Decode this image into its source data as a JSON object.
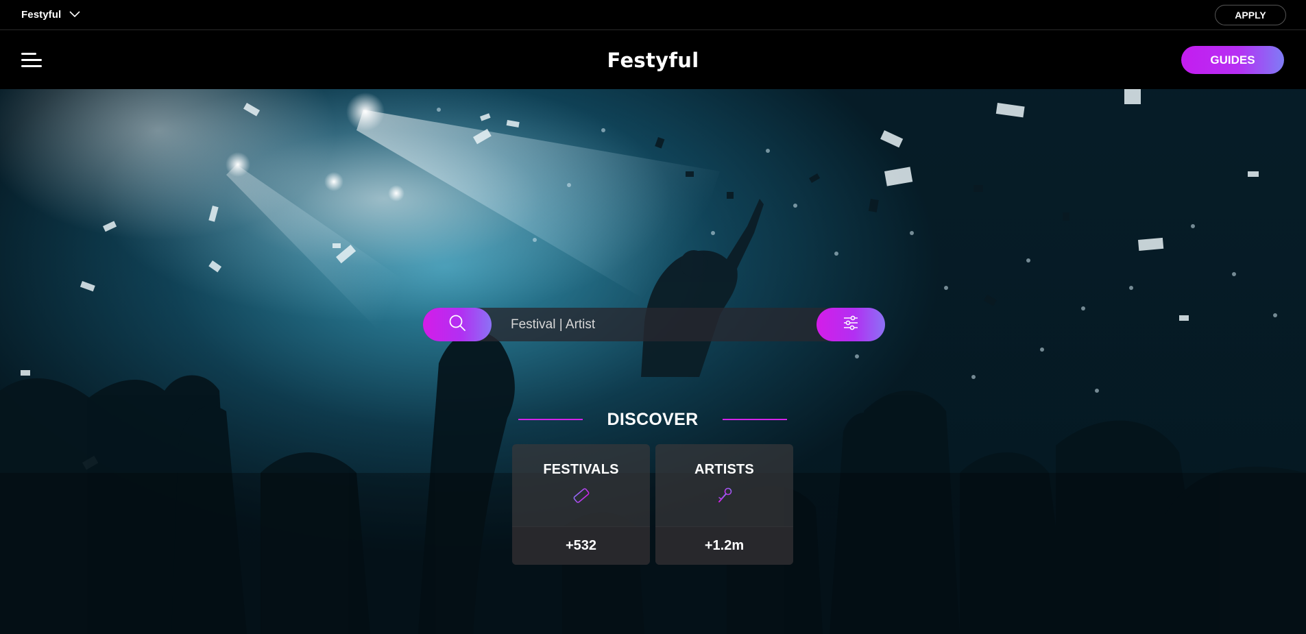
{
  "topbar": {
    "brand_label": "Festyful",
    "apply_label": "APPLY"
  },
  "header": {
    "logo_text": "Festyful",
    "guides_label": "GUIDES"
  },
  "search": {
    "placeholder": "Festival | Artist"
  },
  "discover": {
    "title": "DISCOVER",
    "cards": [
      {
        "title": "FESTIVALS",
        "icon": "ticket-icon",
        "count": "+532"
      },
      {
        "title": "ARTISTS",
        "icon": "microphone-icon",
        "count": "+1.2m"
      }
    ]
  },
  "colors": {
    "accent_start": "#d41de8",
    "accent_end": "#8c72f5",
    "divider": "#d223e8"
  }
}
